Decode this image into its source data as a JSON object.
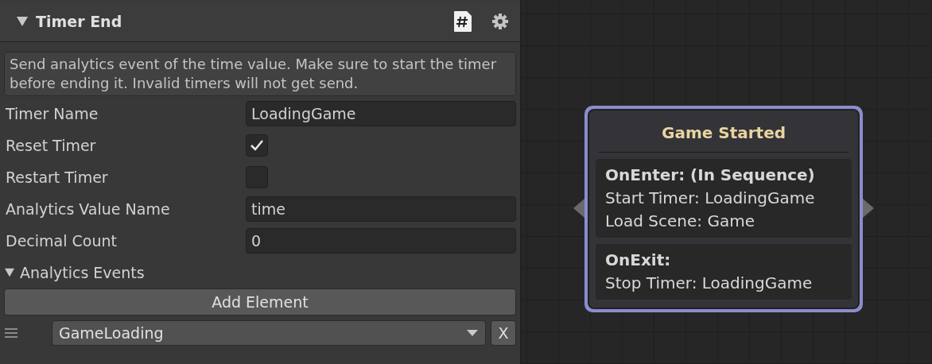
{
  "component": {
    "title": "Timer End",
    "expanded": true
  },
  "description": "Send analytics event of the time value. Make sure to start the timer before ending it. Invalid timers will not get send.",
  "fields": [
    {
      "kind": "text",
      "label": "Timer Name",
      "value": "LoadingGame"
    },
    {
      "kind": "checkbox",
      "label": "Reset Timer",
      "checked": true
    },
    {
      "kind": "checkbox",
      "label": "Restart Timer",
      "checked": false
    },
    {
      "kind": "text",
      "label": "Analytics Value Name",
      "value": "time"
    },
    {
      "kind": "text",
      "label": "Decimal Count",
      "value": "0"
    }
  ],
  "list": {
    "title": "Analytics Events",
    "expanded": true,
    "add_button": "Add Element",
    "items": [
      {
        "value": "GameLoading",
        "remove": "X"
      }
    ]
  },
  "node": {
    "title": "Game Started",
    "selected": true,
    "sections": [
      {
        "heading": "OnEnter: (In Sequence)",
        "lines": [
          "Start Timer: LoadingGame",
          "Load Scene: Game"
        ]
      },
      {
        "heading": "OnExit:",
        "lines": [
          "Stop Timer: LoadingGame"
        ]
      }
    ]
  }
}
